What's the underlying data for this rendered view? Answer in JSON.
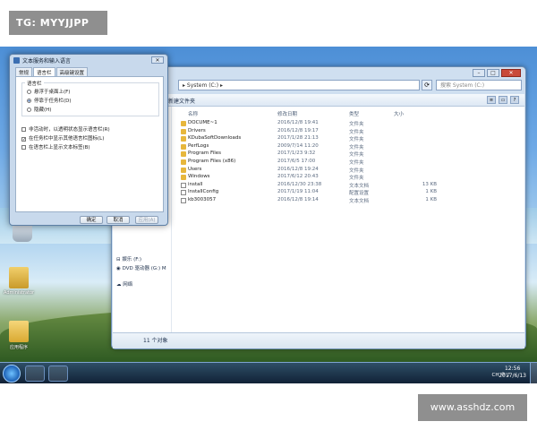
{
  "overlay": {
    "tag": "TG: MYYJJPP",
    "watermark": "www.asshdz.com"
  },
  "desktop": {
    "icons": [
      {
        "label": ""
      },
      {
        "label": "Administrator"
      },
      {
        "label": "应用程序"
      }
    ]
  },
  "explorer": {
    "address": "System (C:)",
    "search_placeholder": "搜索 System (C:)",
    "toolbar_new_folder": "新建文件夹",
    "columns": {
      "name": "名称",
      "date": "修改日期",
      "type": "类型",
      "size": "大小"
    },
    "files": [
      {
        "name": "DOCUME~1",
        "date": "2016/12/8 19:41",
        "type": "文件夹",
        "size": "",
        "icon": "folder"
      },
      {
        "name": "Drivers",
        "date": "2016/12/8 19:17",
        "type": "文件夹",
        "size": "",
        "icon": "folder"
      },
      {
        "name": "KDubaSoftDownloads",
        "date": "2017/1/28 21:13",
        "type": "文件夹",
        "size": "",
        "icon": "folder"
      },
      {
        "name": "PerfLogs",
        "date": "2009/7/14 11:20",
        "type": "文件夹",
        "size": "",
        "icon": "folder"
      },
      {
        "name": "Program Files",
        "date": "2017/1/23 9:32",
        "type": "文件夹",
        "size": "",
        "icon": "folder"
      },
      {
        "name": "Program Files (x86)",
        "date": "2017/6/5 17:00",
        "type": "文件夹",
        "size": "",
        "icon": "folder"
      },
      {
        "name": "Users",
        "date": "2016/12/8 19:24",
        "type": "文件夹",
        "size": "",
        "icon": "folder"
      },
      {
        "name": "Windows",
        "date": "2017/6/12 20:43",
        "type": "文件夹",
        "size": "",
        "icon": "folder"
      },
      {
        "name": "install",
        "date": "2016/12/30 23:38",
        "type": "文本文档",
        "size": "13 KB",
        "icon": "doc"
      },
      {
        "name": "InstallConfig",
        "date": "2017/1/19 11:04",
        "type": "配置设置",
        "size": "1 KB",
        "icon": "doc"
      },
      {
        "name": "kb3003057",
        "date": "2016/12/8 19:14",
        "type": "文本文档",
        "size": "1 KB",
        "icon": "doc"
      }
    ],
    "nav": {
      "drive_f": "娱乐 (F:)",
      "drive_g": "DVD 驱动器 (G:) M",
      "network": "网络"
    },
    "status": "11 个对象"
  },
  "dialog": {
    "title": "文本服务和输入语言",
    "tabs": [
      "常规",
      "语言栏",
      "高级键设置"
    ],
    "active_tab": 1,
    "group_label": "语言栏",
    "options": [
      "悬浮于桌面上(F)",
      "停靠于任务栏(D)",
      "隐藏(H)"
    ],
    "selected_option": 1,
    "checks": [
      {
        "label": "非活动时，以透明状态显示语言栏(R)",
        "checked": false
      },
      {
        "label": "在任务栏中显示其他语言栏图标(L)",
        "checked": true
      },
      {
        "label": "在语言栏上显示文本标签(B)",
        "checked": false
      }
    ],
    "buttons": {
      "ok": "确定",
      "cancel": "取消",
      "apply": "应用(A)"
    }
  },
  "taskbar": {
    "tray_text": "CH 中 ♪",
    "time": "12:56",
    "date": "2017/6/13"
  }
}
